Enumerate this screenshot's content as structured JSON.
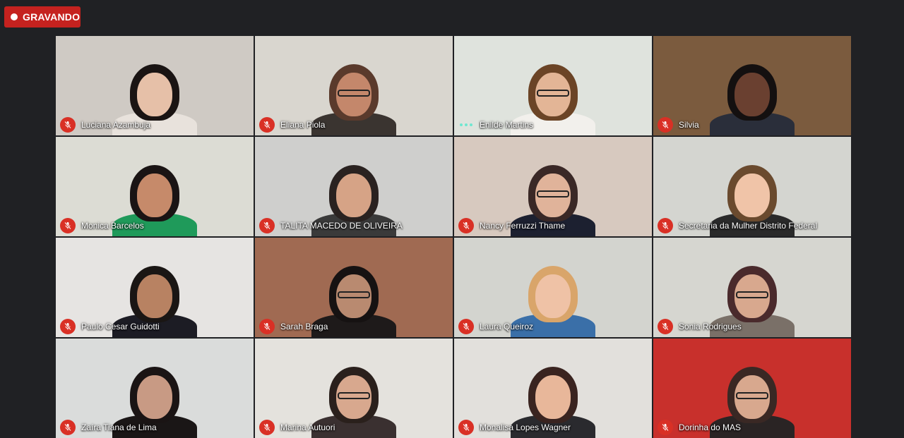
{
  "recording": {
    "label": "GRAVANDO",
    "color": "#c5221f"
  },
  "participants": [
    {
      "name": "Luciana Azambuja",
      "status": "muted",
      "bg": "#cfcac4",
      "skin": "#e6c0a8",
      "hair": "#1a1413",
      "shirt": "#e8e2dc",
      "glasses": false
    },
    {
      "name": "Eliana Piola",
      "status": "muted",
      "bg": "#d9d6cf",
      "skin": "#c4876b",
      "hair": "#5a3a2c",
      "shirt": "#3a3430",
      "glasses": true
    },
    {
      "name": "Enilde Martins",
      "status": "speaking",
      "bg": "#dfe3dd",
      "skin": "#e3b596",
      "hair": "#6b4426",
      "shirt": "#f2f0ec",
      "glasses": true
    },
    {
      "name": "Silvia",
      "status": "muted",
      "bg": "#7b5b3e",
      "skin": "#6a4030",
      "hair": "#141010",
      "shirt": "#2a2e3a",
      "glasses": false
    },
    {
      "name": "Monica Barcelos",
      "status": "muted",
      "bg": "#dcdcd4",
      "skin": "#c68a6a",
      "hair": "#1a1414",
      "shirt": "#1f9a5a",
      "glasses": false
    },
    {
      "name": "TALITA MACEDO DE OLIVEIRA",
      "status": "muted",
      "bg": "#cfcfcd",
      "skin": "#d6a386",
      "hair": "#2a2220",
      "shirt": "#3a3a3a",
      "glasses": false
    },
    {
      "name": "Nancy Ferruzzi Thame",
      "status": "muted",
      "bg": "#d7c9bf",
      "skin": "#e0b39a",
      "hair": "#3a2826",
      "shirt": "#1c2030",
      "glasses": true
    },
    {
      "name": "Secretaria da Mulher Distrito Federal",
      "status": "muted",
      "bg": "#d4d5d0",
      "skin": "#f0c4a8",
      "hair": "#6a4a2e",
      "shirt": "#2a2a2a",
      "glasses": false
    },
    {
      "name": "Paulo Cesar Guidotti",
      "status": "muted",
      "bg": "#e6e4e2",
      "skin": "#b88262",
      "hair": "#1a1614",
      "shirt": "#1c1c24",
      "glasses": false
    },
    {
      "name": "Sarah Braga",
      "status": "muted",
      "bg": "#a06a52",
      "skin": "#b98a70",
      "hair": "#161212",
      "shirt": "#1e1a1a",
      "glasses": true
    },
    {
      "name": "Laura Queiroz",
      "status": "muted",
      "bg": "#d3d4cf",
      "skin": "#efc2a6",
      "hair": "#d9a56a",
      "shirt": "#3a6fa8",
      "glasses": false
    },
    {
      "name": "Sonia Rodrigues",
      "status": "muted",
      "bg": "#d6d6d0",
      "skin": "#d8a88e",
      "hair": "#4a2a2c",
      "shirt": "#7a7068",
      "glasses": true
    },
    {
      "name": "Zaíra Tiana de Lima",
      "status": "muted",
      "bg": "#dadcdb",
      "skin": "#c89a84",
      "hair": "#1a1414",
      "shirt": "#1a1616",
      "glasses": false
    },
    {
      "name": "Marina Autuori",
      "status": "muted",
      "bg": "#e4e2dd",
      "skin": "#d8a88e",
      "hair": "#2a201c",
      "shirt": "#3a3030",
      "glasses": true
    },
    {
      "name": "Monalisa Lopes Wagner",
      "status": "muted",
      "bg": "#e2e0dc",
      "skin": "#e8b79a",
      "hair": "#3a2420",
      "shirt": "#2a2a2e",
      "glasses": false
    },
    {
      "name": "Dorinha do MAS",
      "status": "muted",
      "bg": "#c8302c",
      "skin": "#d8a88e",
      "hair": "#3a2824",
      "shirt": "#2a2424",
      "glasses": true
    }
  ]
}
